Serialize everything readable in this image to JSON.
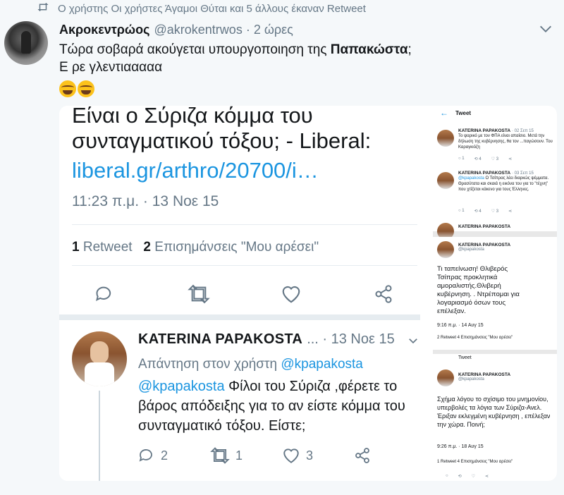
{
  "retweet_banner": "Ο χρήστης Οι χρήστες Άγαμοι Θύται και 5 άλλους έκαναν Retweet",
  "tweet": {
    "name": "Ακροκεντρώος",
    "handle": "@akrokentrwos",
    "time": "2 ώρες",
    "text_before": "Τώρα σοβαρά ακούγεται υπουργοποιηση της ",
    "text_bold": "Παπακώστα",
    "text_after": ";",
    "text_line2": "Ε ρε γλεντιααααα"
  },
  "embedded": {
    "title_line0": "Είναι ο Σύριζα κόμμα του",
    "title_line1": "συνταγματικού τόξου; - Liberal:",
    "link": "liberal.gr/arthro/20700/i…",
    "timestamp": "11:23 π.μ. · 13 Νοε 15",
    "retweets_count": "1",
    "retweets_label": "Retweet",
    "likes_count": "2",
    "likes_label": "Επισημάνσεις \"Μου αρέσει\"",
    "reply": {
      "name": "KATERINA  PAPAKOSTA",
      "meta": "... · 13 Νοε 15",
      "reply_to_label": "Απάντηση στον χρήστη",
      "reply_to_handle": "@kpapakosta",
      "mention": "@kpapakosta",
      "text": " Φίλοι του Σύριζα ,φέρετε το βάρος απόδειξης για το αν είστε κόμμα του συνταγματικό τόξου. Είστε;",
      "replies": "2",
      "retweets": "1",
      "likes": "3"
    }
  },
  "right_pane": {
    "header": "Tweet",
    "items": [
      {
        "name": "KATERINA PAPAKOSTA",
        "meta": "· 02 Σεπ 15",
        "text": "Το ψαρικό με τον ΦΠΑ είναι απαίσιο. Μετά την δήλωση της κυβέρνησης, θα τον ...παγώσουν. Του Καραγκιόζη"
      },
      {
        "name": "KATERINA PAPAKOSTA",
        "meta": "· 03 Σεπ 15",
        "mention": "@kpapakosta",
        "text": " Ο Τσίπρας λέει διαρκώς ψέμματα. Θρασύτατα και σκαιά η εικόνα του για το \"τέχνη\" που χτίζεται κάκενο για τους Έλληνες."
      },
      {
        "name": "KATERINA PAPAKOSTA",
        "handle": "@kpapakosta",
        "text": "Τι ταπείνωση! Θλιβερός Τσίπρας προκλητικά αμοραλιστής.Θλιβερή κυβέρνηση. . Ντρέπομαι για λογαριασμό όσων τους επέλεξαν.",
        "date": "9:16 π.μ. · 14 Αυγ 15",
        "stats": "2 Retweet  4 Επισημάνσεις \"Μου αρέσει\""
      },
      {
        "name": "KATERINA PAPAKOSTA",
        "handle": "@kpapakosta",
        "text": "Σχήμα λόγου το σχίσιμο του μνημονίου, υπερβολές τα λόγια των Σύριζα-Ανελ. Έριξαν εκλεγμένη κυβέρνηση , επέλεξαν την χώρα. Ποινή;",
        "date": "9:26 π.μ. · 18 Αυγ 15",
        "stats": "1 Retweet  4 Επισημάνσεις \"Μου αρέσει\"",
        "top_label": "Tweet"
      }
    ]
  }
}
